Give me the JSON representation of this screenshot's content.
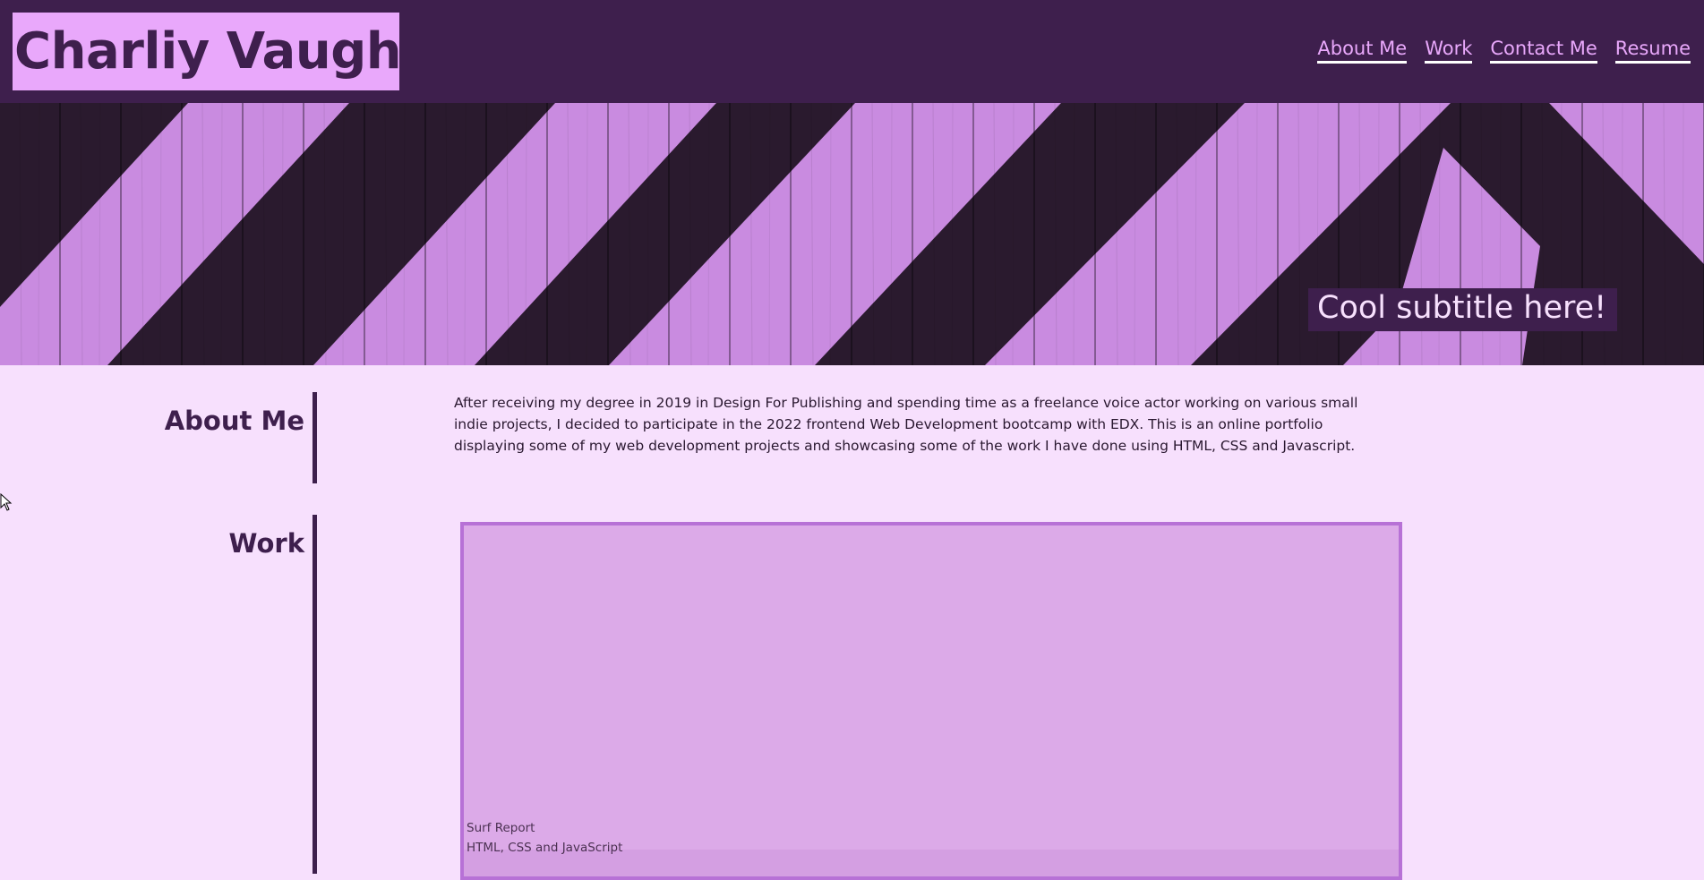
{
  "header": {
    "title": "Charliy Vaughan",
    "nav": [
      {
        "label": "About Me"
      },
      {
        "label": "Work"
      },
      {
        "label": "Contact Me"
      },
      {
        "label": "Resume"
      }
    ]
  },
  "hero": {
    "subtitle": "Cool subtitle here!"
  },
  "about": {
    "heading": "About Me",
    "body": "After receiving my degree in 2019 in Design For Publishing and spending time as a freelance voice actor working on various small indie projects, I decided to participate in the 2022 frontend Web Development bootcamp with EDX. This is an online portfolio displaying some of my web development projects and showcasing some of the work I have done using HTML, CSS and Javascript."
  },
  "work": {
    "heading": "Work",
    "projects": [
      {
        "title": "Surf Report",
        "tech": "HTML, CSS and JavaScript"
      }
    ]
  },
  "colors": {
    "header_bg": "#3e1f4d",
    "accent": "#e9a8fb",
    "page_bg": "#f7e0fd",
    "card_border": "#b771d6"
  }
}
